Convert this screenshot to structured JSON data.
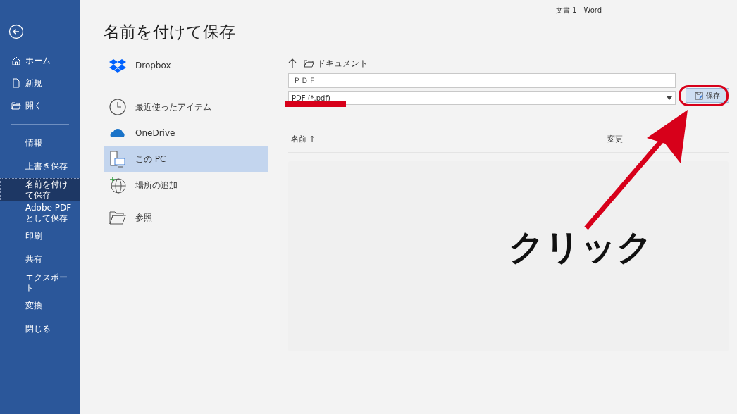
{
  "window": {
    "title": "文書 1  -  Word"
  },
  "sidebar": {
    "items": [
      {
        "label": "ホーム",
        "kind": "home",
        "selected": false
      },
      {
        "label": "新規",
        "kind": "new",
        "selected": false
      },
      {
        "label": "開く",
        "kind": "open",
        "selected": false
      },
      {
        "label": "情報",
        "kind": "text",
        "selected": false
      },
      {
        "label": "上書き保存",
        "kind": "text",
        "selected": false
      },
      {
        "label": "名前を付けて保存",
        "kind": "text",
        "selected": true
      },
      {
        "label": "Adobe PDF として保存",
        "kind": "text",
        "selected": false
      },
      {
        "label": "印刷",
        "kind": "text",
        "selected": false
      },
      {
        "label": "共有",
        "kind": "text",
        "selected": false
      },
      {
        "label": "エクスポート",
        "kind": "text",
        "selected": false
      },
      {
        "label": "変換",
        "kind": "text",
        "selected": false
      },
      {
        "label": "閉じる",
        "kind": "text",
        "selected": false
      }
    ]
  },
  "page_title": "名前を付けて保存",
  "locations": [
    {
      "label": "Dropbox",
      "kind": "dropbox",
      "selected": false
    },
    {
      "label": "最近使ったアイテム",
      "kind": "recent",
      "selected": false
    },
    {
      "label": "OneDrive",
      "kind": "onedrive",
      "selected": false
    },
    {
      "label": "この PC",
      "kind": "pc",
      "selected": true
    },
    {
      "label": "場所の追加",
      "kind": "add",
      "selected": false
    },
    {
      "label": "参照",
      "kind": "browse",
      "selected": false
    }
  ],
  "breadcrumb": "ドキュメント",
  "file_name": {
    "value": "ＰＤＦ"
  },
  "file_type": {
    "value": "PDF (*.pdf)"
  },
  "save_button": "保存",
  "columns": [
    "名前 ↑",
    "変更"
  ],
  "annotation": {
    "label": "クリック"
  }
}
